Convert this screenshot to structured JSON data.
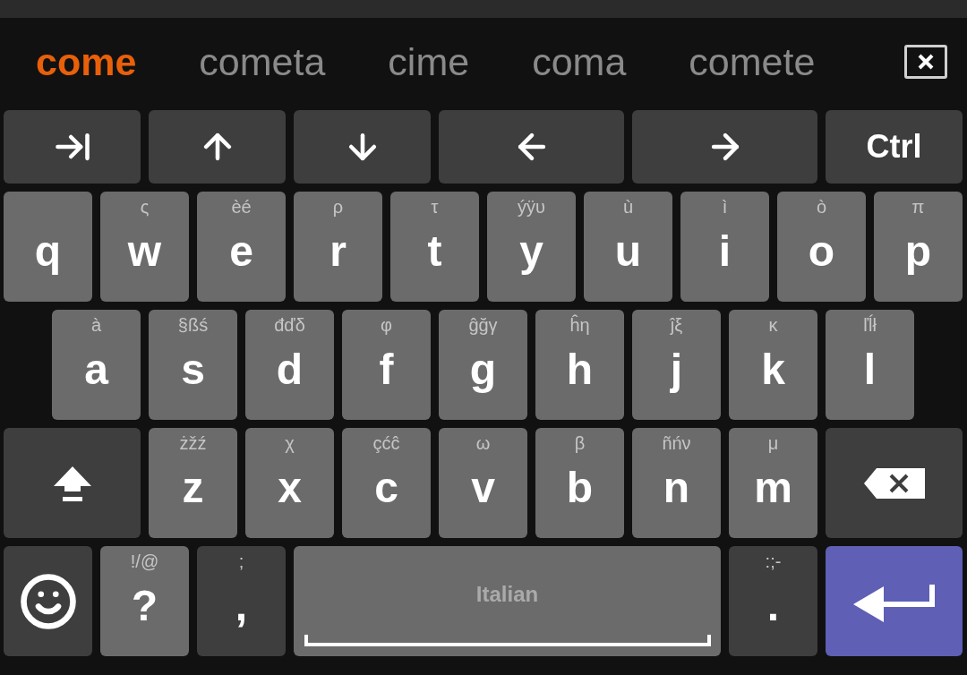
{
  "suggestions": [
    {
      "text": "come",
      "selected": true
    },
    {
      "text": "cometa",
      "selected": false
    },
    {
      "text": "cime",
      "selected": false
    },
    {
      "text": "coma",
      "selected": false
    },
    {
      "text": "comete",
      "selected": false
    }
  ],
  "rows": [
    {
      "keys": [
        {
          "kind": "tab"
        },
        {
          "kind": "up"
        },
        {
          "kind": "down"
        },
        {
          "kind": "left"
        },
        {
          "kind": "right"
        },
        {
          "kind": "text",
          "label": "Ctrl"
        }
      ]
    },
    {
      "keys": [
        {
          "kind": "letter",
          "label": "q"
        },
        {
          "kind": "letter",
          "label": "w",
          "hint": "ς"
        },
        {
          "kind": "letter",
          "label": "e",
          "hint": "èé"
        },
        {
          "kind": "letter",
          "label": "r",
          "hint": "ρ"
        },
        {
          "kind": "letter",
          "label": "t",
          "hint": "τ"
        },
        {
          "kind": "letter",
          "label": "y",
          "hint": "ýÿυ"
        },
        {
          "kind": "letter",
          "label": "u",
          "hint": "ù"
        },
        {
          "kind": "letter",
          "label": "i",
          "hint": "ì"
        },
        {
          "kind": "letter",
          "label": "o",
          "hint": "ò"
        },
        {
          "kind": "letter",
          "label": "p",
          "hint": "π"
        }
      ]
    },
    {
      "keys": [
        {
          "kind": "letter",
          "label": "a",
          "hint": "à"
        },
        {
          "kind": "letter",
          "label": "s",
          "hint": "§ßś"
        },
        {
          "kind": "letter",
          "label": "d",
          "hint": "đďδ"
        },
        {
          "kind": "letter",
          "label": "f",
          "hint": "φ"
        },
        {
          "kind": "letter",
          "label": "g",
          "hint": "ĝğγ"
        },
        {
          "kind": "letter",
          "label": "h",
          "hint": "ĥη"
        },
        {
          "kind": "letter",
          "label": "j",
          "hint": "ĵξ"
        },
        {
          "kind": "letter",
          "label": "k",
          "hint": "κ"
        },
        {
          "kind": "letter",
          "label": "l",
          "hint": "ľĺł"
        }
      ]
    },
    {
      "keys": [
        {
          "kind": "shift"
        },
        {
          "kind": "letter",
          "label": "z",
          "hint": "żžź"
        },
        {
          "kind": "letter",
          "label": "x",
          "hint": "χ"
        },
        {
          "kind": "letter",
          "label": "c",
          "hint": "çćĉ"
        },
        {
          "kind": "letter",
          "label": "v",
          "hint": "ω"
        },
        {
          "kind": "letter",
          "label": "b",
          "hint": "β"
        },
        {
          "kind": "letter",
          "label": "n",
          "hint": "ñńν"
        },
        {
          "kind": "letter",
          "label": "m",
          "hint": "μ"
        },
        {
          "kind": "backspace"
        }
      ]
    },
    {
      "keys": [
        {
          "kind": "emoji"
        },
        {
          "kind": "letter",
          "label": "?",
          "hint": "!/@"
        },
        {
          "kind": "symbol",
          "label": ",",
          "hint": ";"
        },
        {
          "kind": "space",
          "label": "Italian"
        },
        {
          "kind": "symbol",
          "label": ".",
          "hint": ":;-"
        },
        {
          "kind": "enter"
        }
      ]
    }
  ]
}
